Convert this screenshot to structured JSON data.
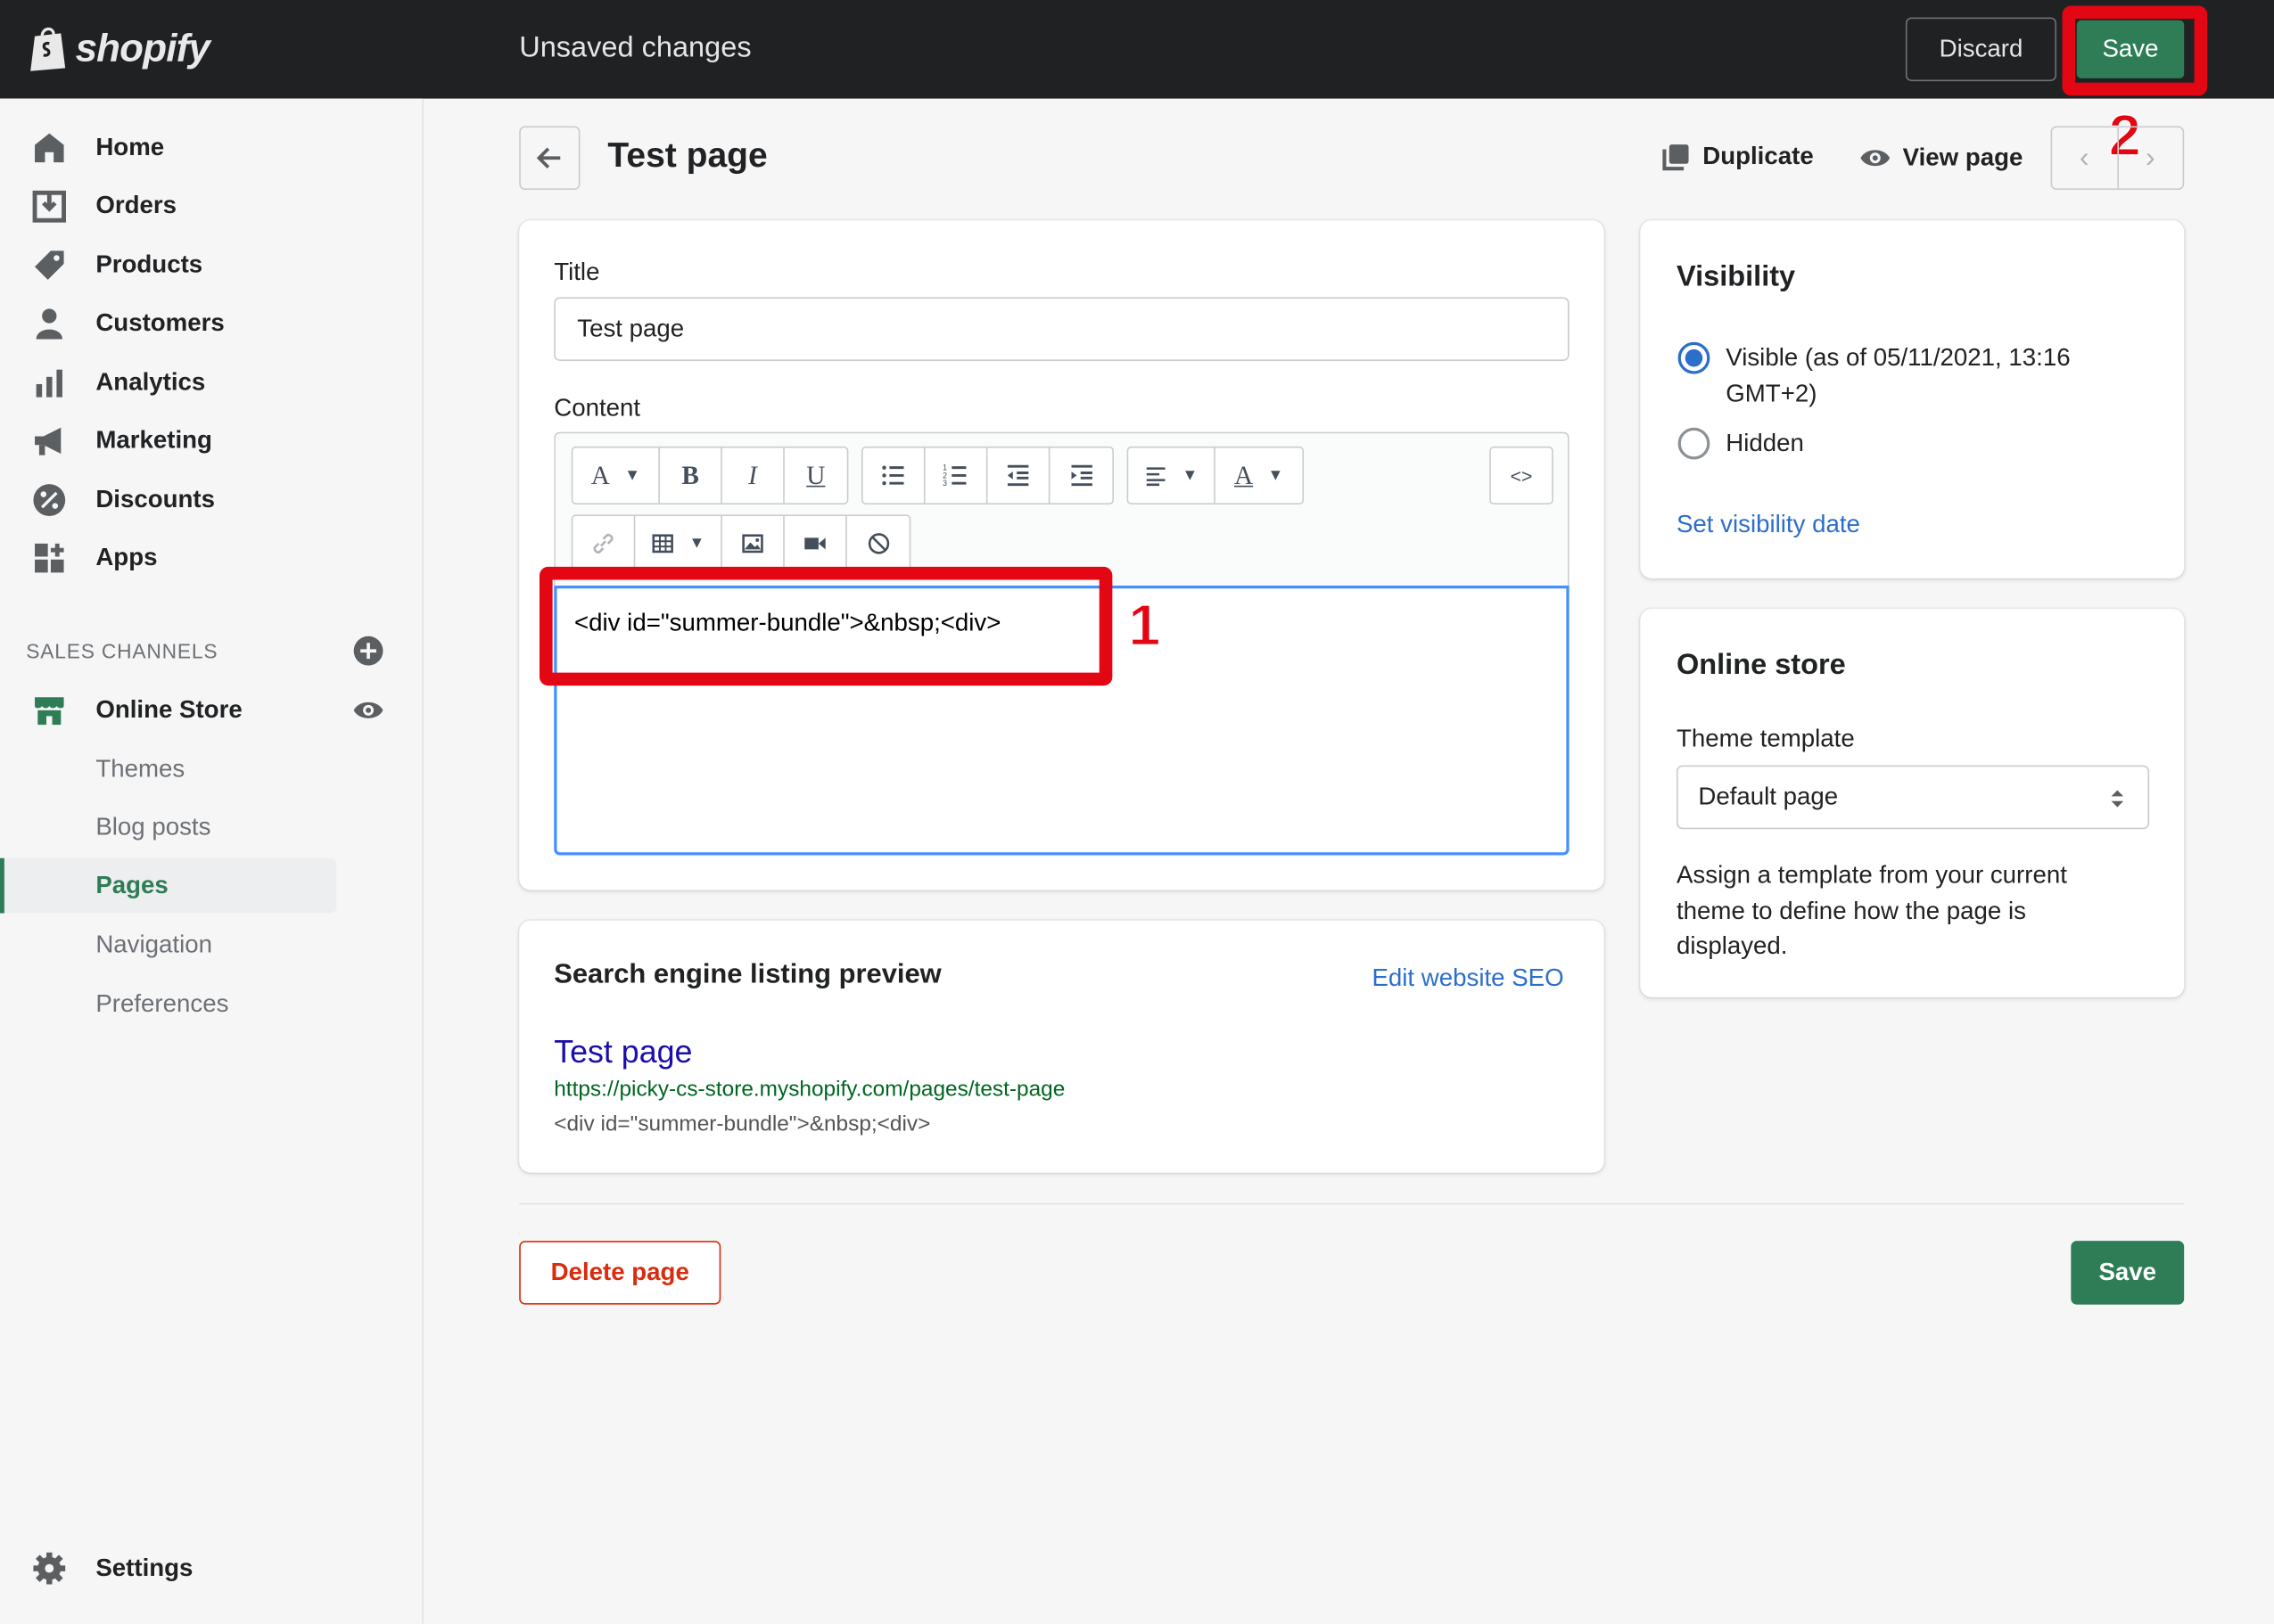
{
  "topbar": {
    "brand": "shopify",
    "title": "Unsaved changes",
    "discard_label": "Discard",
    "save_label": "Save"
  },
  "annotations": {
    "one": "1",
    "two": "2"
  },
  "sidebar": {
    "items": [
      {
        "label": "Home",
        "icon": "home-icon"
      },
      {
        "label": "Orders",
        "icon": "orders-icon"
      },
      {
        "label": "Products",
        "icon": "tag-icon"
      },
      {
        "label": "Customers",
        "icon": "person-icon"
      },
      {
        "label": "Analytics",
        "icon": "bar-chart-icon"
      },
      {
        "label": "Marketing",
        "icon": "megaphone-icon"
      },
      {
        "label": "Discounts",
        "icon": "discount-icon"
      },
      {
        "label": "Apps",
        "icon": "apps-icon"
      }
    ],
    "sales_channels_heading": "SALES CHANNELS",
    "online_store": "Online Store",
    "sub_items": [
      "Themes",
      "Blog posts",
      "Pages",
      "Navigation",
      "Preferences"
    ],
    "active_sub_item": "Pages",
    "settings": "Settings"
  },
  "header": {
    "title": "Test page",
    "duplicate": "Duplicate",
    "view_page": "View page"
  },
  "editor_card": {
    "title_label": "Title",
    "title_value": "Test page",
    "content_label": "Content",
    "content_value": "<div id=\"summer-bundle\">&nbsp;<div>",
    "toolbar": {
      "font": "A",
      "bold": "B",
      "italic": "I",
      "underline": "U",
      "text_color": "A",
      "html": "<>"
    }
  },
  "seo_card": {
    "heading": "Search engine listing preview",
    "edit_link": "Edit website SEO",
    "title": "Test page",
    "url": "https://picky-cs-store.myshopify.com/pages/test-page",
    "description": "<div id=\"summer-bundle\">&nbsp;<div>"
  },
  "visibility_card": {
    "heading": "Visibility",
    "visible_label_line1": "Visible (as of 05/11/2021, 13:16",
    "visible_label_line2": "GMT+2)",
    "hidden_label": "Hidden",
    "selected": "Visible",
    "set_date_link": "Set visibility date"
  },
  "online_store_card": {
    "heading": "Online store",
    "template_label": "Theme template",
    "template_value": "Default page",
    "help_line1": "Assign a template from your current",
    "help_line2": "theme to define how the page is",
    "help_line3": "displayed."
  },
  "footer": {
    "delete_label": "Delete page",
    "save_label": "Save"
  },
  "colors": {
    "brand_green": "#2e7d57",
    "topbar": "#202123",
    "link_blue": "#2c6ecb",
    "danger": "#d82c0d",
    "annotation_red": "#e30613"
  }
}
